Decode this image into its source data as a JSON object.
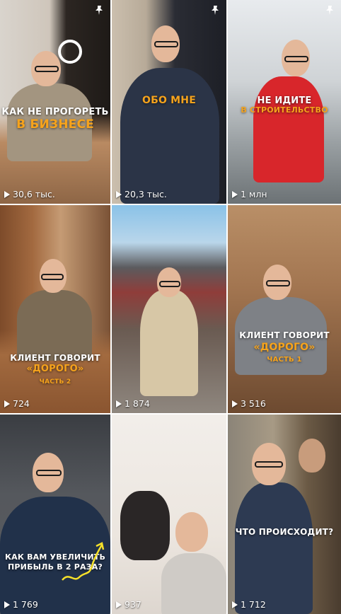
{
  "tiles": [
    {
      "caption_lines": [
        "КАК НЕ ПРОГОРЕТЬ",
        "В БИЗНЕСЕ"
      ],
      "views": "30,6 тыс.",
      "pinned": true
    },
    {
      "caption_lines": [
        "ОБО МНЕ"
      ],
      "views": "20,3 тыс.",
      "pinned": true
    },
    {
      "caption_lines": [
        "НЕ ИДИТЕ",
        "В СТРОИТЕЛЬСТВО"
      ],
      "views": "1 млн",
      "pinned": true
    },
    {
      "caption_lines": [
        "КЛИЕНТ ГОВОРИТ",
        "«ДОРОГО»",
        "ЧАСТЬ 2"
      ],
      "views": "724",
      "pinned": false
    },
    {
      "caption_lines": [],
      "views": "1 874",
      "pinned": false
    },
    {
      "caption_lines": [
        "КЛИЕНТ ГОВОРИТ",
        "«ДОРОГО»",
        "ЧАСТЬ 1"
      ],
      "views": "3 516",
      "pinned": false
    },
    {
      "caption_lines": [
        "КАК ВАМ УВЕЛИЧИТЬ",
        "ПРИБЫЛЬ В 2 РАЗА?"
      ],
      "views": "1 769",
      "pinned": false
    },
    {
      "caption_lines": [],
      "views": "937",
      "pinned": false
    },
    {
      "caption_lines": [
        "ЧТО ПРОИСХОДИТ?"
      ],
      "views": "1 712",
      "pinned": false
    }
  ],
  "icons": {
    "pin": "pin-icon",
    "play": "play-icon"
  },
  "colors": {
    "accent_orange": "#f6a31c",
    "white": "#ffffff"
  }
}
